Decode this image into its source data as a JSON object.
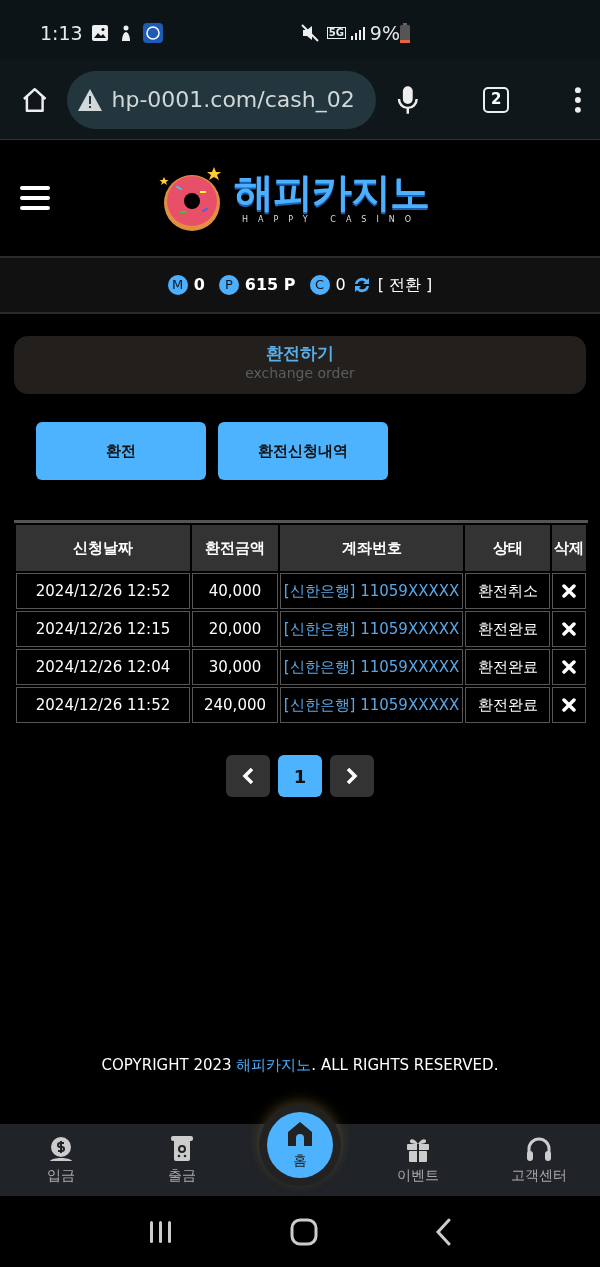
{
  "status_bar": {
    "time": "1:13",
    "battery_text": "9%",
    "network": "5G"
  },
  "browser": {
    "url": "hp-0001.com/cash_02",
    "tab_count": "2"
  },
  "logo": {
    "title": "해피카지노",
    "subtitle": "HAPPY CASINO"
  },
  "balances": [
    {
      "badge": "M",
      "value": "0"
    },
    {
      "badge": "P",
      "value": "615 P"
    },
    {
      "badge": "C",
      "value": "0"
    }
  ],
  "convert_label": "[ 전환 ]",
  "section": {
    "title": "환전하기",
    "subtitle": "exchange order"
  },
  "actions": [
    "환전",
    "환전신청내역"
  ],
  "table": {
    "columns": [
      "신청날짜",
      "환전금액",
      "계좌번호",
      "상태",
      "삭제"
    ],
    "rows": [
      {
        "date": "2024/12/26 12:52",
        "amount": "40,000",
        "account": "[신한은행] 11059XXXXX",
        "status": "환전취소"
      },
      {
        "date": "2024/12/26 12:15",
        "amount": "20,000",
        "account": "[신한은행] 11059XXXXX",
        "status": "환전완료"
      },
      {
        "date": "2024/12/26 12:04",
        "amount": "30,000",
        "account": "[신한은행] 11059XXXXX",
        "status": "환전완료"
      },
      {
        "date": "2024/12/26 11:52",
        "amount": "240,000",
        "account": "[신한은행] 11059XXXXX",
        "status": "환전완료"
      }
    ]
  },
  "pagination": [
    {
      "label": "1",
      "selected": true
    }
  ],
  "copyright": {
    "before": "COPYRIGHT 2023 ",
    "brand": "해피카지노",
    "after": ". ALL RIGHTS RESERVED."
  },
  "bottom_nav": [
    {
      "kind": "deposit",
      "label": "입금",
      "selected": false
    },
    {
      "kind": "withdraw",
      "label": "출금",
      "selected": false
    },
    {
      "kind": "home",
      "label": "홈",
      "selected": true
    },
    {
      "kind": "event",
      "label": "이벤트",
      "selected": false
    },
    {
      "kind": "support",
      "label": "고객센터",
      "selected": false
    }
  ]
}
